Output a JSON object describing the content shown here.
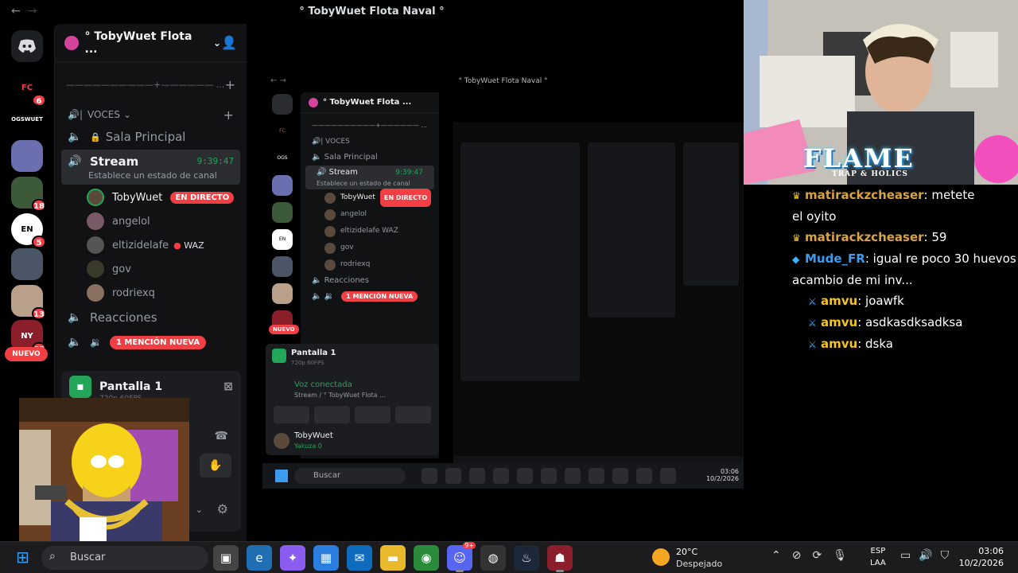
{
  "window": {
    "title": "° TobyWuet Flota Naval °",
    "back": "←",
    "forward": "→"
  },
  "rail": {
    "servers": [
      {
        "label": "",
        "badge": ""
      },
      {
        "label": "FC",
        "badge": "6"
      },
      {
        "label": "OGSWUET",
        "badge": ""
      },
      {
        "label": "",
        "badge": ""
      },
      {
        "label": "",
        "badge": "18"
      },
      {
        "label": "EN",
        "badge": "5"
      },
      {
        "label": "",
        "badge": ""
      },
      {
        "label": "",
        "badge": "13"
      },
      {
        "label": "NY",
        "badge": "65"
      }
    ],
    "nuevo": "NUEVO"
  },
  "server": {
    "name": "° TobyWuet Flota ...",
    "divider_text": "——————————+—————— ...",
    "category": "VOCES",
    "channels": {
      "sala": "Sala Principal",
      "stream": "Stream",
      "stream_time": "9:39:47",
      "stream_status": "Establece un estado de canal",
      "reacciones": "Reacciones"
    },
    "users": [
      {
        "name": "TobyWuet",
        "badge": "EN DIRECTO"
      },
      {
        "name": "angelol"
      },
      {
        "name": "eltizidelafe",
        "badge": "WAZ"
      },
      {
        "name": "gov"
      },
      {
        "name": "rodriexq"
      }
    ],
    "mention": "1 MENCIÓN NUEVA"
  },
  "panel": {
    "title": "Pantalla 1",
    "fps": "720p 60FPS",
    "voice": "Voz conectada",
    "voice_sub": "Stream / ° TobyWuet Flota ...",
    "user": "TobyWuet",
    "user_sub": "Yakuza 0"
  },
  "overlay": {
    "logo": "FLAME",
    "logo_sub": "TRAP & HOLICS",
    "chat": [
      {
        "user": "matirackzcheaser",
        "text": ": metete",
        "icon": "crown"
      },
      {
        "user": "",
        "text": "el oyito",
        "icon": ""
      },
      {
        "user": "matirackzcheaser",
        "text": ": 59",
        "icon": "crown"
      },
      {
        "user": "Mude_FR",
        "text": ": igual re poco 30 huevos",
        "icon": "diamond"
      },
      {
        "user": "",
        "text": "acambio de mi inv...",
        "icon": ""
      },
      {
        "user": "amvu",
        "text": ": joawfk",
        "icon": "sword"
      },
      {
        "user": "amvu",
        "text": ": asdkasdksadksa",
        "icon": "sword"
      },
      {
        "user": "amvu",
        "text": ": dska",
        "icon": "sword"
      }
    ]
  },
  "taskbar": {
    "search": "Buscar",
    "weather_temp": "20°C",
    "weather_desc": "Despejado",
    "lang1": "ESP",
    "lang2": "LAA",
    "time": "03:06",
    "date": "10/2/2026",
    "discord_badge": "9+"
  },
  "colors": {
    "accent_red": "#f23f43",
    "online_green": "#23a55a",
    "discord_blurple": "#5865f2"
  }
}
